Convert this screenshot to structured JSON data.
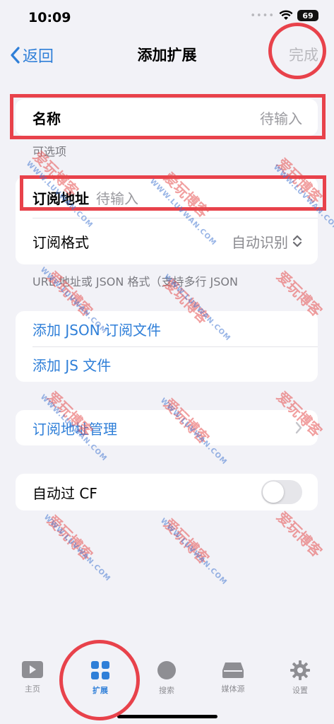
{
  "status": {
    "time": "10:09",
    "battery": "69"
  },
  "nav": {
    "back_label": "返回",
    "title": "添加扩展",
    "done_label": "完成"
  },
  "name_field": {
    "label": "名称",
    "placeholder": "待输入"
  },
  "name_note": "可选项",
  "subscription": {
    "url_label": "订阅地址",
    "url_placeholder": "待输入",
    "format_label": "订阅格式",
    "format_value": "自动识别"
  },
  "format_note": "URL 地址或 JSON 格式（支持多行 JSON",
  "add_actions": {
    "add_json": "添加 JSON 订阅文件",
    "add_js": "添加 JS 文件"
  },
  "manage": {
    "label": "订阅地址管理"
  },
  "auto_cf": {
    "label": "自动过 CF",
    "enabled": false
  },
  "tabs": [
    {
      "label": "主页",
      "icon": "play-icon"
    },
    {
      "label": "扩展",
      "icon": "grid-icon",
      "active": true
    },
    {
      "label": "搜索",
      "icon": "circle-icon"
    },
    {
      "label": "媒体源",
      "icon": "drive-icon"
    },
    {
      "label": "设置",
      "icon": "gear-icon"
    }
  ],
  "watermark": {
    "main": "爱玩博客",
    "sub": "WWW.LUVWAN.COM"
  },
  "colors": {
    "accent": "#2f7fd8",
    "annotation": "#e8424b",
    "background": "#f2f2f7"
  }
}
